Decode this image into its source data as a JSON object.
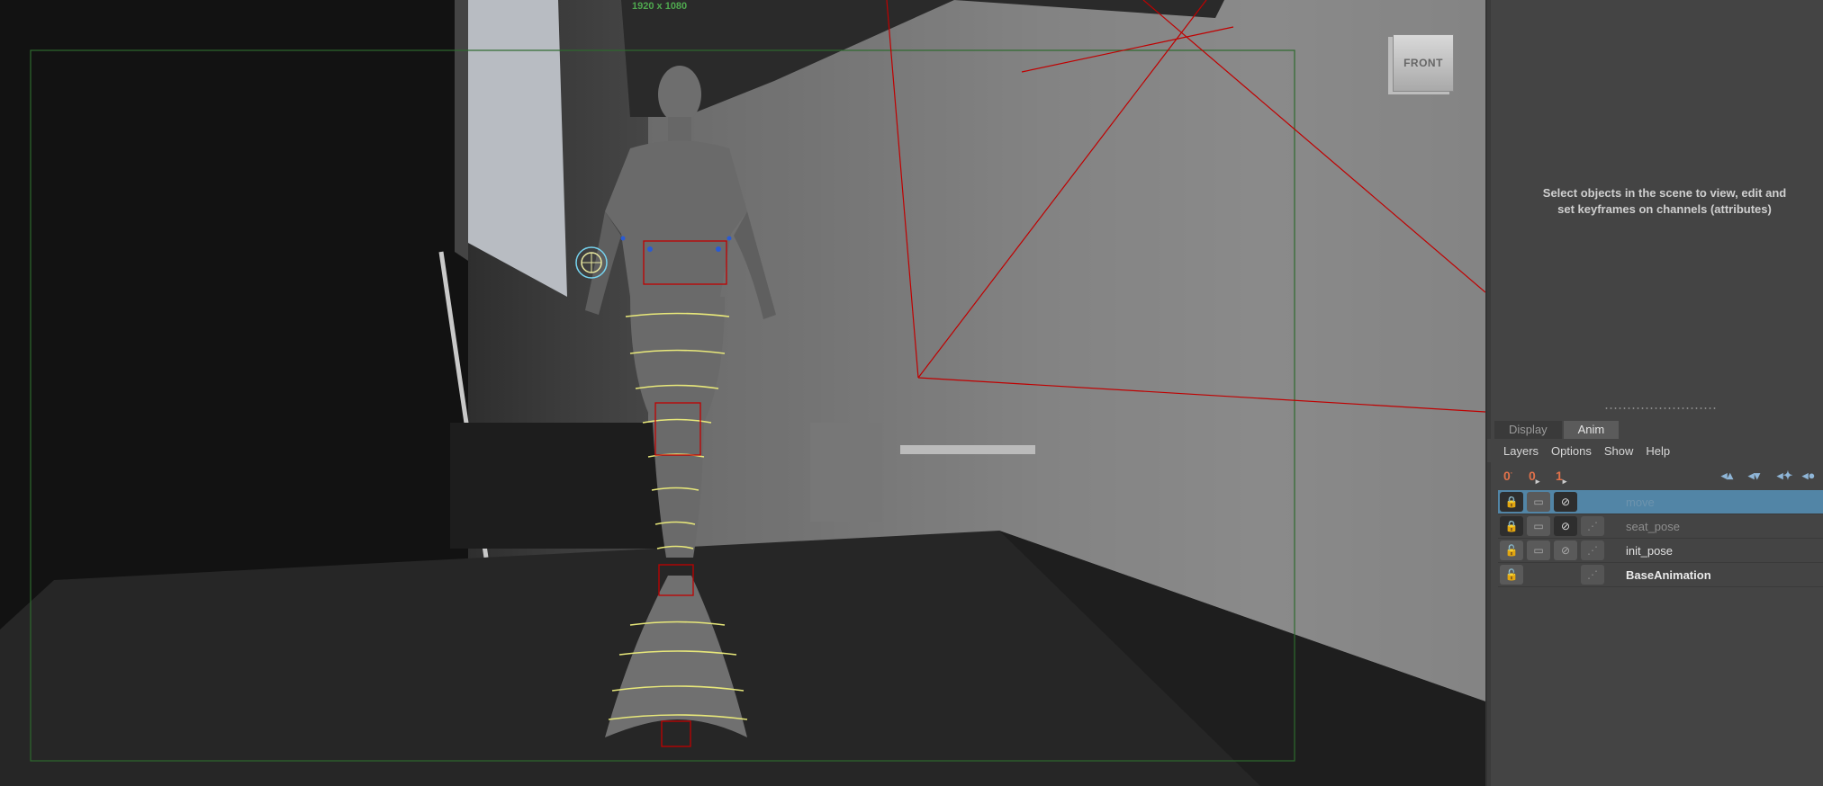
{
  "viewport": {
    "resolution_label": "1920 x 1080",
    "viewcube_label": "FRONT"
  },
  "channel_box": {
    "message": "Select objects in the scene to view, edit and set keyframes on channels (attributes)"
  },
  "layer_editor": {
    "tabs": [
      {
        "label": "Display",
        "active": false
      },
      {
        "label": "Anim",
        "active": true
      }
    ],
    "menu": [
      "Layers",
      "Options",
      "Show",
      "Help"
    ],
    "toolbar_left": [
      {
        "icon": "zero-key-icon",
        "label": "0"
      },
      {
        "icon": "zero-key-selected-icon",
        "label": "0"
      },
      {
        "icon": "one-key-icon",
        "label": "1"
      }
    ],
    "toolbar_right_icons": [
      "move-layer-up-icon",
      "move-layer-down-icon",
      "create-empty-layer-icon",
      "create-layer-from-selection-icon"
    ],
    "layers": [
      {
        "name": "move",
        "selected": true,
        "lock": "locked",
        "ghost": false
      },
      {
        "name": "seat_pose",
        "selected": false,
        "lock": "locked",
        "ghost": true
      },
      {
        "name": "init_pose",
        "selected": false,
        "lock": "unlocked",
        "ghost": true
      },
      {
        "name": "BaseAnimation",
        "selected": false,
        "lock": "unlocked",
        "ghost": true
      }
    ]
  },
  "colors": {
    "selection_blue": "#5285a6",
    "key_orange": "#e0714a",
    "camera_line_red": "#c00000",
    "rig_yellow": "#e8e87a",
    "resolution_gate_green": "#2d6a2d"
  }
}
